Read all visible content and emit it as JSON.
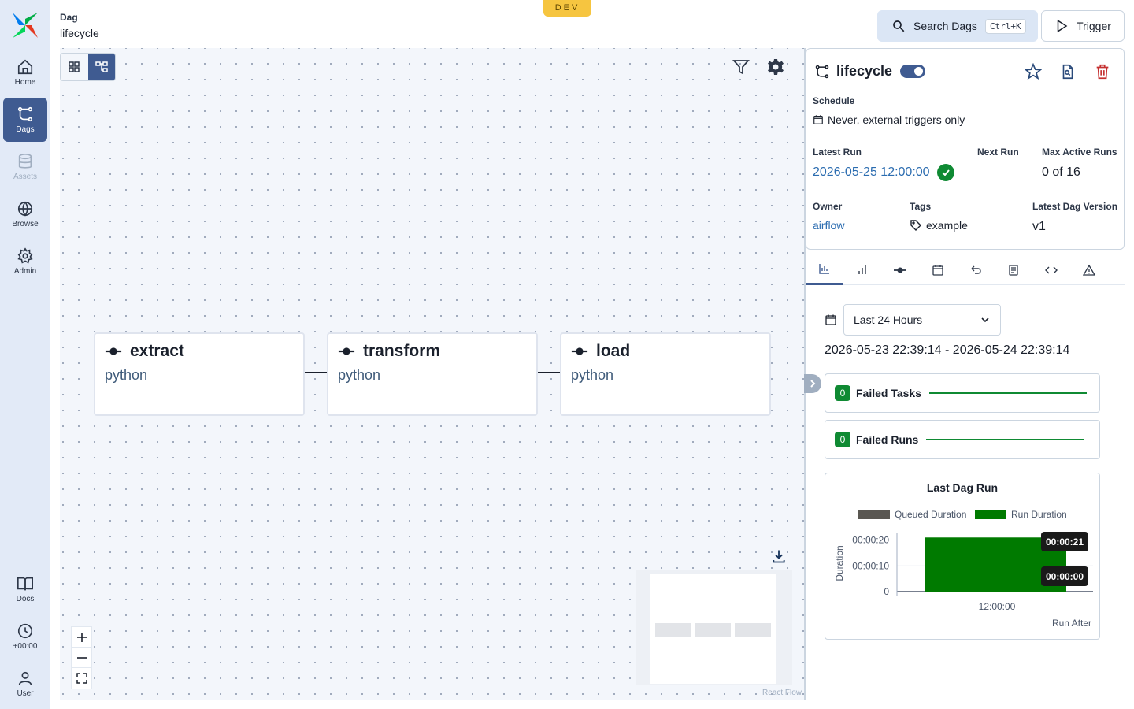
{
  "nav": {
    "items": [
      {
        "label": "Home",
        "icon": "home-icon"
      },
      {
        "label": "Dags",
        "icon": "dags-icon"
      },
      {
        "label": "Assets",
        "icon": "database-icon"
      },
      {
        "label": "Browse",
        "icon": "globe-icon"
      },
      {
        "label": "Admin",
        "icon": "gear-icon"
      },
      {
        "label": "Docs",
        "icon": "book-icon"
      },
      {
        "label": "+00:00",
        "icon": "clock-icon"
      },
      {
        "label": "User",
        "icon": "user-icon"
      }
    ],
    "active": "Dags",
    "active_color": "#3f5b91"
  },
  "header": {
    "breadcrumb_label": "Dag",
    "title": "lifecycle",
    "env_badge": "DEV",
    "search_label": "Search Dags",
    "search_shortcut": "Ctrl+K",
    "trigger_label": "Trigger"
  },
  "graph": {
    "nodes": [
      {
        "name": "extract",
        "operator": "python"
      },
      {
        "name": "transform",
        "operator": "python"
      },
      {
        "name": "load",
        "operator": "python"
      }
    ],
    "attribution": "React Flow"
  },
  "details": {
    "dag_id": "lifecycle",
    "paused": false,
    "schedule_label": "Schedule",
    "schedule_value": "Never, external triggers only",
    "latest_run_label": "Latest Run",
    "latest_run_value": "2026-05-25 12:00:00",
    "latest_run_state": "success",
    "next_run_label": "Next Run",
    "max_active_runs_label": "Max Active Runs",
    "max_active_runs_value": "0 of 16",
    "owner_label": "Owner",
    "owner_value": "airflow",
    "tags_label": "Tags",
    "tags_value": "example",
    "version_label": "Latest Dag Version",
    "version_value": "v1"
  },
  "tabs": [
    "overview-icon",
    "grid-icon",
    "tasks-icon",
    "calendar-icon",
    "backfills-icon",
    "events-icon",
    "code-icon",
    "warning-icon"
  ],
  "overview": {
    "time_range": "Last 24 Hours",
    "range_text": "2026-05-23 22:39:14 - 2026-05-24 22:39:14",
    "failed_tasks_count": "0",
    "failed_tasks_label": "Failed Tasks",
    "failed_runs_count": "0",
    "failed_runs_label": "Failed Runs"
  },
  "chart_data": {
    "type": "bar",
    "title": "Last Dag Run",
    "xlabel": "Run After",
    "ylabel": "Duration",
    "categories": [
      "12:00:00"
    ],
    "series": [
      {
        "name": "Queued Duration",
        "values": [
          0
        ],
        "color": "#5a5752"
      },
      {
        "name": "Run Duration",
        "values": [
          21
        ],
        "color": "#007a00"
      }
    ],
    "yticks": [
      "0",
      "00:00:10",
      "00:00:20"
    ],
    "ylim": [
      0,
      22
    ],
    "data_labels": [
      "00:00:21",
      "00:00:00"
    ],
    "stacked": true,
    "legend": "top"
  },
  "colors": {
    "success": "#0f8a33",
    "accent": "#3f5b91",
    "link": "#2b6cb0",
    "danger": "#c53030"
  }
}
